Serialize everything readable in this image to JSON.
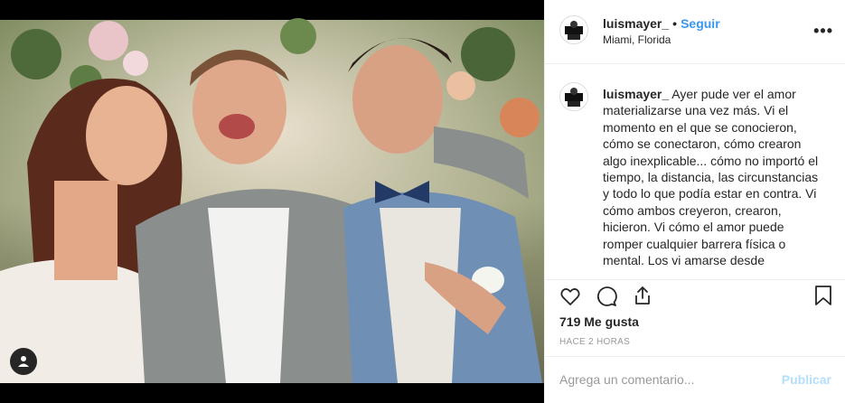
{
  "post": {
    "username": "luismayer_",
    "separator": "•",
    "follow_label": "Seguir",
    "location": "Miami, Florida",
    "more_label": "•••",
    "caption_username": "luismayer_",
    "caption_text": "Ayer pude ver el amor materializarse una vez más. Vi el momento en el que se conocieron, cómo se conectaron, cómo crearon algo inexplicable... cómo no importó el tiempo, la distancia, las circunstancias y todo lo que podía estar en contra. Vi cómo ambos creyeron, crearon, hicieron. Vi cómo el amor puede romper cualquier barrera física o mental. Los vi amarse desde",
    "likes": "719 Me gusta",
    "time": "HACE 2 HORAS",
    "comment_placeholder": "Agrega un comentario...",
    "publish_label": "Publicar"
  },
  "icons": {
    "like": "heart-icon",
    "comment": "comment-icon",
    "share": "share-icon",
    "save": "bookmark-icon",
    "user_tag": "user-tag-icon",
    "more": "more-options-icon"
  },
  "colors": {
    "accent": "#3897f0",
    "publish_disabled": "#b2dffc",
    "text": "#262626",
    "muted": "#999999",
    "border": "#efefef"
  }
}
